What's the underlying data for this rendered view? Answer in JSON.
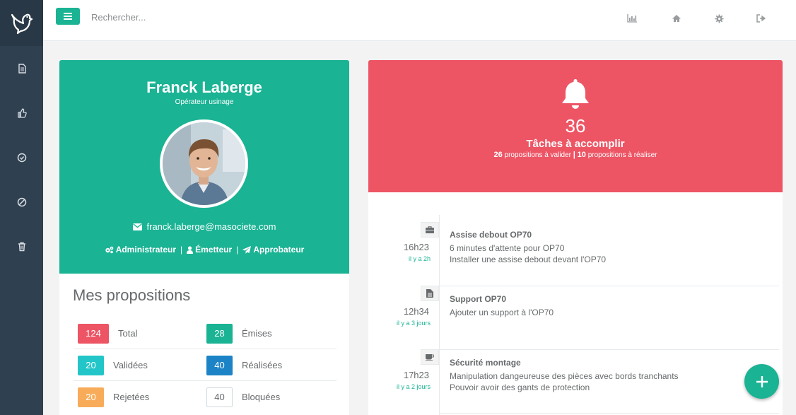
{
  "search": {
    "placeholder": "Rechercher..."
  },
  "sidebar": {
    "items": [
      {
        "icon": "document-icon"
      },
      {
        "icon": "thumbs-up-icon"
      },
      {
        "icon": "check-circle-icon"
      },
      {
        "icon": "ban-icon"
      },
      {
        "icon": "trash-icon"
      }
    ]
  },
  "topbar": {
    "icons": [
      "bar-chart-icon",
      "home-icon",
      "gear-icon",
      "sign-out-icon"
    ]
  },
  "profile": {
    "name": "Franck Laberge",
    "role": "Opérateur usinage",
    "email": "franck.laberge@masociete.com",
    "roles": [
      "Administrateur",
      "Émetteur",
      "Approbateur"
    ],
    "separator": "|"
  },
  "propositions": {
    "title": "Mes propositions",
    "rows": [
      [
        {
          "value": "124",
          "label": "Total",
          "color": "#ed5565"
        },
        {
          "value": "28",
          "label": "Émises",
          "color": "#1ab394"
        }
      ],
      [
        {
          "value": "20",
          "label": "Validées",
          "color": "#23c6c8"
        },
        {
          "value": "40",
          "label": "Réalisées",
          "color": "#1c84c6"
        }
      ],
      [
        {
          "value": "20",
          "label": "Rejetées",
          "color": "#f8ac59"
        },
        {
          "value": "40",
          "label": "Bloquées",
          "color": "#ffffff"
        }
      ]
    ]
  },
  "tasks": {
    "count": "36",
    "title": "Tâches à accomplir",
    "to_validate_count": "26",
    "to_validate_label": "propositions à valider",
    "separator": "|",
    "to_realize_count": "10",
    "to_realize_label": "propositions à réaliser"
  },
  "timeline": [
    {
      "icon": "briefcase-icon",
      "time": "16h23",
      "ago": "il y a 2h",
      "title": "Assise debout OP70",
      "lines": [
        "6 minutes d'attente pour OP70",
        "Installer une assise debout devant l'OP70"
      ]
    },
    {
      "icon": "file-icon",
      "time": "12h34",
      "ago": "il y a 3 jours",
      "title": "Support OP70",
      "lines": [
        "Ajouter un support à l'OP70",
        ""
      ]
    },
    {
      "icon": "coffee-icon",
      "time": "17h23",
      "ago": "il y a 2 jours",
      "title": "Sécurité montage",
      "lines": [
        "Manipulation dangeureuse des pièces avec bords tranchants",
        "Pouvoir avoir des gants de protection"
      ]
    }
  ],
  "colors": {
    "primary": "#1ab394",
    "danger": "#ed5565",
    "sidebar": "#2f4050"
  }
}
